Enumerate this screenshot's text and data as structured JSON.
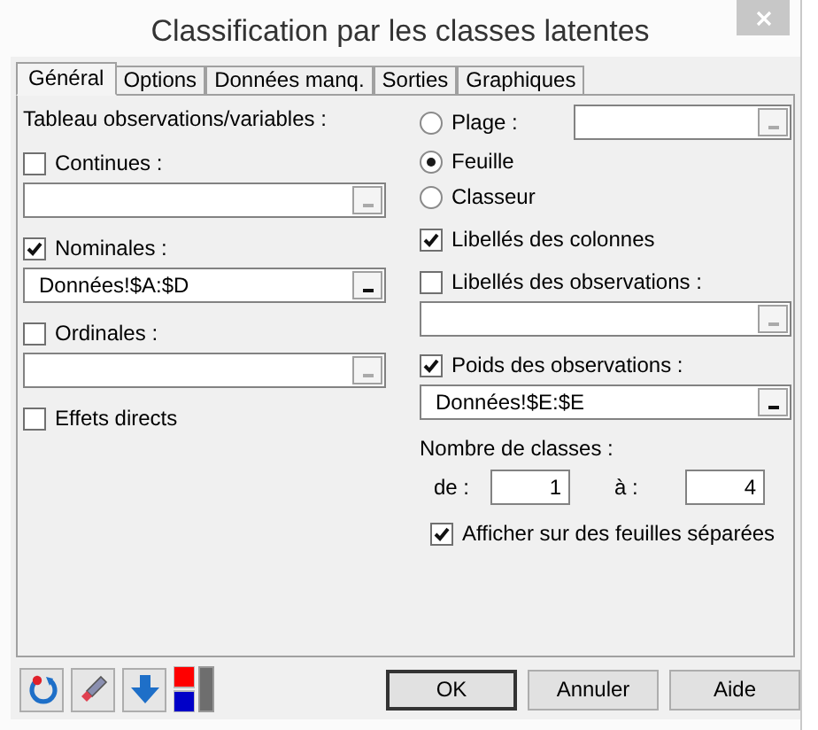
{
  "window": {
    "title": "Classification par les classes latentes"
  },
  "tabs": [
    {
      "label": "Général",
      "selected": true
    },
    {
      "label": "Options",
      "selected": false
    },
    {
      "label": "Données manq.",
      "selected": false
    },
    {
      "label": "Sorties",
      "selected": false
    },
    {
      "label": "Graphiques",
      "selected": false
    }
  ],
  "left": [
    {
      "items": [
        {
          "kind": "label",
          "text": "Tableau observations/variables :"
        }
      ]
    },
    {
      "items": [
        {
          "kind": "checkbox",
          "label": "Continues :",
          "checked": false
        },
        {
          "kind": "field",
          "enabled": false
        }
      ]
    },
    {
      "items": [
        {
          "kind": "checkbox",
          "label": "Nominales :",
          "checked": true
        },
        {
          "kind": "field",
          "value": "Données!$A:$D",
          "enabled": true
        }
      ]
    },
    {
      "items": [
        {
          "kind": "checkbox",
          "label": "Ordinales :",
          "checked": false
        },
        {
          "kind": "field",
          "enabled": false
        }
      ]
    },
    {
      "items": [
        {
          "kind": "checkbox",
          "label": "Effets directs",
          "checked": false
        }
      ]
    }
  ],
  "right": [
    {
      "items": [
        {
          "kind": "radio",
          "label": "Plage :",
          "selected": false,
          "field": {
            "enabled": false
          }
        },
        {
          "kind": "radio",
          "label": "Feuille",
          "selected": true
        },
        {
          "kind": "radio",
          "label": "Classeur",
          "selected": false
        }
      ]
    },
    {
      "items": [
        {
          "kind": "checkbox",
          "label": "Libellés des colonnes",
          "checked": true
        }
      ]
    },
    {
      "items": [
        {
          "kind": "checkbox",
          "label": "Libellés des observations :",
          "checked": false
        },
        {
          "kind": "field",
          "enabled": false
        }
      ]
    },
    {
      "items": [
        {
          "kind": "checkbox",
          "label": "Poids des observations :",
          "checked": true
        },
        {
          "kind": "field",
          "value": "Données!$E:$E",
          "enabled": true
        }
      ]
    },
    {
      "items": [
        {
          "kind": "label",
          "text": "Nombre de classes :"
        },
        {
          "kind": "range",
          "from_label": "de :",
          "from": "1",
          "to_label": "à :",
          "to": "4"
        }
      ]
    },
    {
      "items": [
        {
          "kind": "checkbox",
          "label": "Afficher sur des feuilles séparées",
          "checked": true,
          "indent": true
        }
      ]
    }
  ],
  "buttons": [
    {
      "label": "OK",
      "default": true
    },
    {
      "label": "Annuler",
      "default": false
    },
    {
      "label": "Aide",
      "default": false
    }
  ]
}
